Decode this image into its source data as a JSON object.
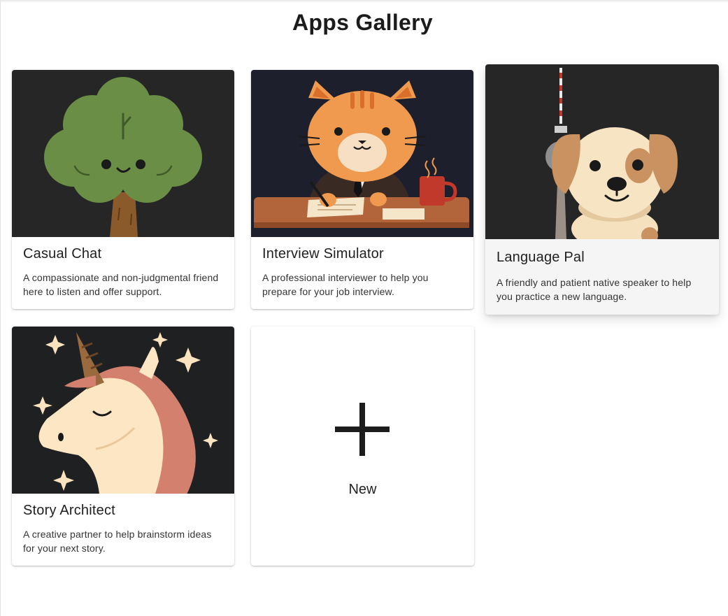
{
  "page": {
    "title": "Apps Gallery"
  },
  "cards": [
    {
      "title": "Casual Chat",
      "description": "A compassionate and non-judgmental friend here to listen and offer support.",
      "icon": "tree-character-icon"
    },
    {
      "title": "Interview Simulator",
      "description": "A professional interviewer to help you prepare for your job interview.",
      "icon": "cat-interviewer-icon"
    },
    {
      "title": "Language Pal",
      "description": "A friendly and patient native speaker to help you practice a new language.",
      "icon": "dog-tower-icon"
    },
    {
      "title": "Story Architect",
      "description": "A creative partner to help brainstorm ideas for your next story.",
      "icon": "unicorn-icon"
    }
  ],
  "new_card": {
    "label": "New",
    "icon": "plus-icon"
  },
  "colors": {
    "image_background": "#262626",
    "card_background": "#ffffff",
    "hover_card_background": "#f5f5f5",
    "text": "#1f1f1f"
  }
}
